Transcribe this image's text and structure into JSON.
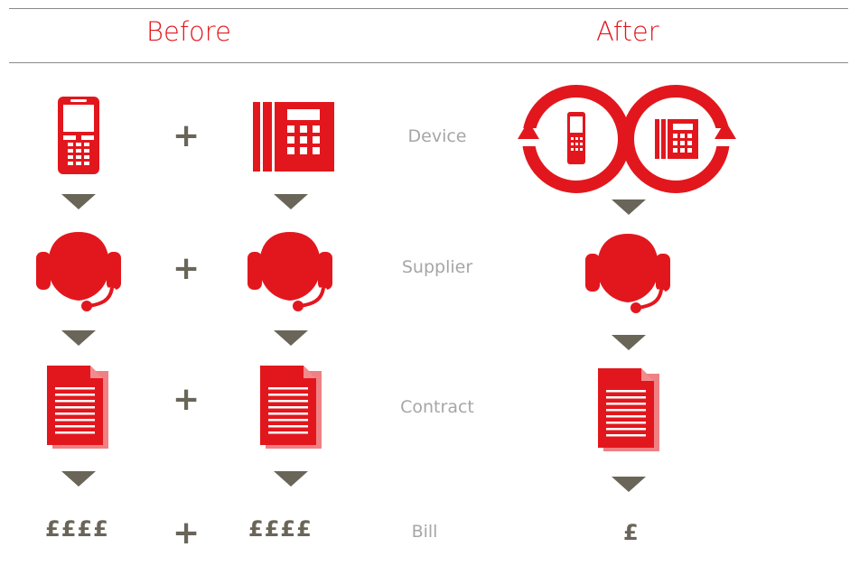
{
  "header": {
    "before_label": "Before",
    "after_label": "After"
  },
  "rows": {
    "device": "Device",
    "supplier": "Supplier",
    "contract": "Contract",
    "bill": "Bill"
  },
  "plus_symbol": "+",
  "bill": {
    "before_amount": "££££",
    "after_amount": "£"
  },
  "colors": {
    "accent": "#e2171d",
    "arrow": "#6a6559",
    "label": "#a6a6a6"
  }
}
